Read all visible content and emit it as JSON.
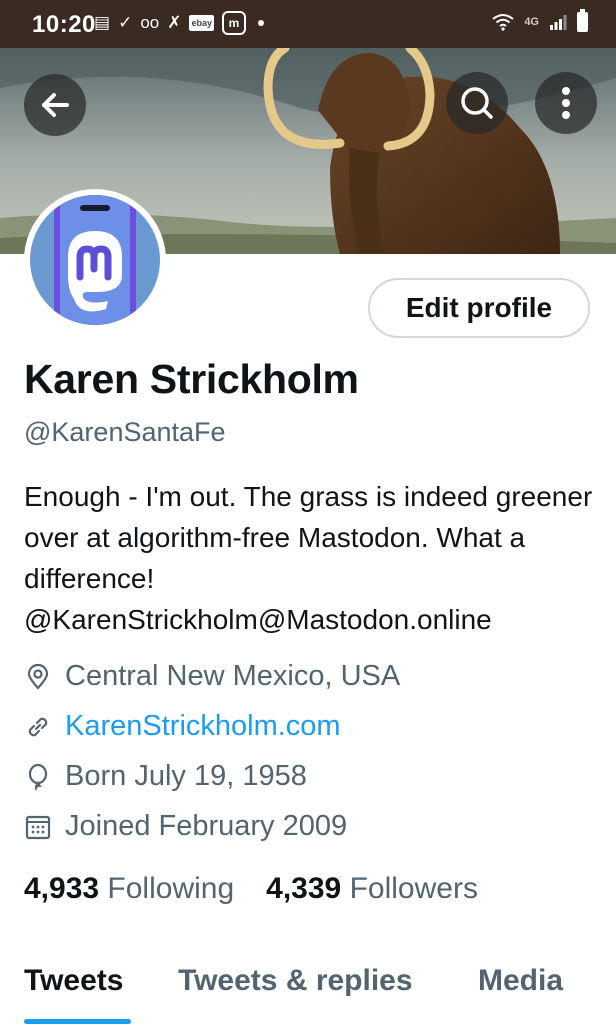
{
  "status_bar": {
    "time": "10:20",
    "network": "4G",
    "icons": [
      "message-icon",
      "check-circle-icon",
      "voicemail-icon",
      "missed-call-icon",
      "ebay-icon",
      "mastodon-icon",
      "dot-icon",
      "wifi-icon",
      "signal-icon",
      "battery-icon"
    ],
    "ebay_label": "ebay",
    "mastodon_label": "m"
  },
  "header": {
    "icons": [
      "back-arrow-icon",
      "search-icon",
      "more-vertical-icon"
    ]
  },
  "profile": {
    "edit_label": "Edit profile",
    "name": "Karen Strickholm",
    "handle": "@KarenSantaFe",
    "bio": "Enough - I'm out. The grass is indeed greener over at algorithm-free Mastodon. What a difference! @KarenStrickholm@Mastodon.online",
    "location": "Central New Mexico, USA",
    "website": "KarenStrickholm.com",
    "born": "Born July 19, 1958",
    "joined": "Joined February 2009",
    "following_count": "4,933",
    "following_label": "Following",
    "followers_count": "4,339",
    "followers_label": "Followers"
  },
  "tabs": [
    {
      "label": "Tweets",
      "active": true
    },
    {
      "label": "Tweets & replies",
      "active": false
    },
    {
      "label": "Media",
      "active": false
    }
  ],
  "colors": {
    "accent": "#1d9bf0",
    "text_primary": "#0f1419",
    "text_secondary": "#536471",
    "status_bar": "#3b2a22",
    "avatar_bg": "#6b9ad2",
    "mastodon_purple": "#6364ff"
  }
}
